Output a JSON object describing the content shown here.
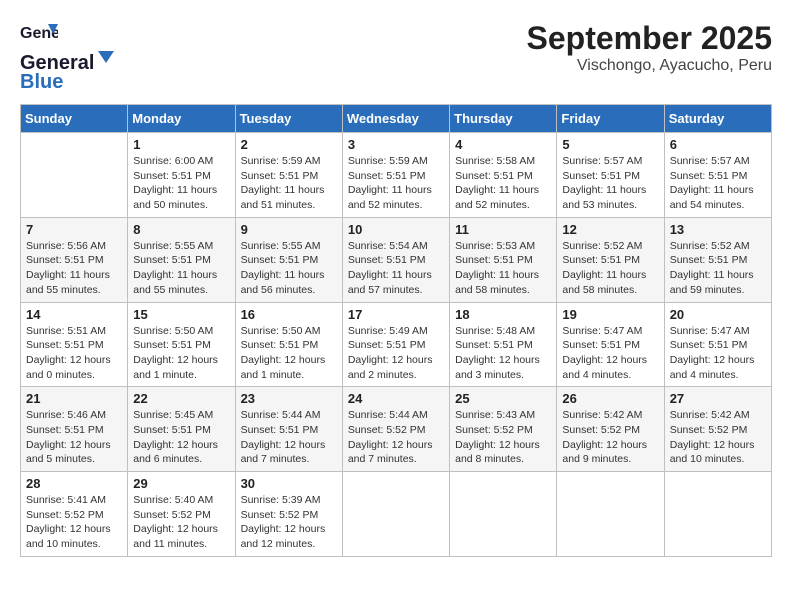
{
  "logo": {
    "text_general": "General",
    "text_blue": "Blue"
  },
  "title": {
    "month": "September 2025",
    "location": "Vischongo, Ayacucho, Peru"
  },
  "weekdays": [
    "Sunday",
    "Monday",
    "Tuesday",
    "Wednesday",
    "Thursday",
    "Friday",
    "Saturday"
  ],
  "weeks": [
    [
      {
        "day": "",
        "info": ""
      },
      {
        "day": "1",
        "info": "Sunrise: 6:00 AM\nSunset: 5:51 PM\nDaylight: 11 hours\nand 50 minutes."
      },
      {
        "day": "2",
        "info": "Sunrise: 5:59 AM\nSunset: 5:51 PM\nDaylight: 11 hours\nand 51 minutes."
      },
      {
        "day": "3",
        "info": "Sunrise: 5:59 AM\nSunset: 5:51 PM\nDaylight: 11 hours\nand 52 minutes."
      },
      {
        "day": "4",
        "info": "Sunrise: 5:58 AM\nSunset: 5:51 PM\nDaylight: 11 hours\nand 52 minutes."
      },
      {
        "day": "5",
        "info": "Sunrise: 5:57 AM\nSunset: 5:51 PM\nDaylight: 11 hours\nand 53 minutes."
      },
      {
        "day": "6",
        "info": "Sunrise: 5:57 AM\nSunset: 5:51 PM\nDaylight: 11 hours\nand 54 minutes."
      }
    ],
    [
      {
        "day": "7",
        "info": "Sunrise: 5:56 AM\nSunset: 5:51 PM\nDaylight: 11 hours\nand 55 minutes."
      },
      {
        "day": "8",
        "info": "Sunrise: 5:55 AM\nSunset: 5:51 PM\nDaylight: 11 hours\nand 55 minutes."
      },
      {
        "day": "9",
        "info": "Sunrise: 5:55 AM\nSunset: 5:51 PM\nDaylight: 11 hours\nand 56 minutes."
      },
      {
        "day": "10",
        "info": "Sunrise: 5:54 AM\nSunset: 5:51 PM\nDaylight: 11 hours\nand 57 minutes."
      },
      {
        "day": "11",
        "info": "Sunrise: 5:53 AM\nSunset: 5:51 PM\nDaylight: 11 hours\nand 58 minutes."
      },
      {
        "day": "12",
        "info": "Sunrise: 5:52 AM\nSunset: 5:51 PM\nDaylight: 11 hours\nand 58 minutes."
      },
      {
        "day": "13",
        "info": "Sunrise: 5:52 AM\nSunset: 5:51 PM\nDaylight: 11 hours\nand 59 minutes."
      }
    ],
    [
      {
        "day": "14",
        "info": "Sunrise: 5:51 AM\nSunset: 5:51 PM\nDaylight: 12 hours\nand 0 minutes."
      },
      {
        "day": "15",
        "info": "Sunrise: 5:50 AM\nSunset: 5:51 PM\nDaylight: 12 hours\nand 1 minute."
      },
      {
        "day": "16",
        "info": "Sunrise: 5:50 AM\nSunset: 5:51 PM\nDaylight: 12 hours\nand 1 minute."
      },
      {
        "day": "17",
        "info": "Sunrise: 5:49 AM\nSunset: 5:51 PM\nDaylight: 12 hours\nand 2 minutes."
      },
      {
        "day": "18",
        "info": "Sunrise: 5:48 AM\nSunset: 5:51 PM\nDaylight: 12 hours\nand 3 minutes."
      },
      {
        "day": "19",
        "info": "Sunrise: 5:47 AM\nSunset: 5:51 PM\nDaylight: 12 hours\nand 4 minutes."
      },
      {
        "day": "20",
        "info": "Sunrise: 5:47 AM\nSunset: 5:51 PM\nDaylight: 12 hours\nand 4 minutes."
      }
    ],
    [
      {
        "day": "21",
        "info": "Sunrise: 5:46 AM\nSunset: 5:51 PM\nDaylight: 12 hours\nand 5 minutes."
      },
      {
        "day": "22",
        "info": "Sunrise: 5:45 AM\nSunset: 5:51 PM\nDaylight: 12 hours\nand 6 minutes."
      },
      {
        "day": "23",
        "info": "Sunrise: 5:44 AM\nSunset: 5:51 PM\nDaylight: 12 hours\nand 7 minutes."
      },
      {
        "day": "24",
        "info": "Sunrise: 5:44 AM\nSunset: 5:52 PM\nDaylight: 12 hours\nand 7 minutes."
      },
      {
        "day": "25",
        "info": "Sunrise: 5:43 AM\nSunset: 5:52 PM\nDaylight: 12 hours\nand 8 minutes."
      },
      {
        "day": "26",
        "info": "Sunrise: 5:42 AM\nSunset: 5:52 PM\nDaylight: 12 hours\nand 9 minutes."
      },
      {
        "day": "27",
        "info": "Sunrise: 5:42 AM\nSunset: 5:52 PM\nDaylight: 12 hours\nand 10 minutes."
      }
    ],
    [
      {
        "day": "28",
        "info": "Sunrise: 5:41 AM\nSunset: 5:52 PM\nDaylight: 12 hours\nand 10 minutes."
      },
      {
        "day": "29",
        "info": "Sunrise: 5:40 AM\nSunset: 5:52 PM\nDaylight: 12 hours\nand 11 minutes."
      },
      {
        "day": "30",
        "info": "Sunrise: 5:39 AM\nSunset: 5:52 PM\nDaylight: 12 hours\nand 12 minutes."
      },
      {
        "day": "",
        "info": ""
      },
      {
        "day": "",
        "info": ""
      },
      {
        "day": "",
        "info": ""
      },
      {
        "day": "",
        "info": ""
      }
    ]
  ]
}
